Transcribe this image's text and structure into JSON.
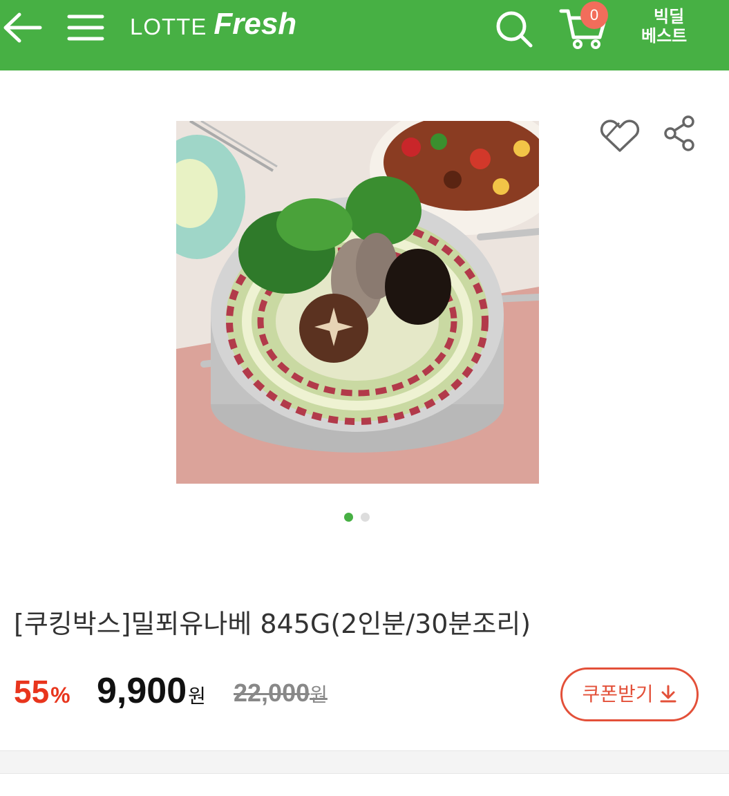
{
  "header": {
    "logo_lotte": "LOTTE",
    "logo_fresh": "Fresh",
    "cart_count": "0",
    "bigdeal_line1": "빅딜",
    "bigdeal_line2": "베스트",
    "icons": [
      "back-arrow-icon",
      "hamburger-menu-icon",
      "search-icon",
      "cart-icon"
    ],
    "accent_color": "#47b044"
  },
  "product": {
    "image_icons": [
      "wishlist-heart-icon",
      "share-icon"
    ],
    "carousel_dots": 2,
    "carousel_active": 1,
    "title": "[쿠킹박스]밀푀유나베 845G(2인분/30분조리)",
    "discount_value": "55",
    "discount_symbol": "%",
    "price": "9,900",
    "price_unit": "원",
    "original_price": "22,000",
    "original_unit": "원",
    "coupon_label": "쿠폰받기",
    "discount_color": "#e8351d"
  }
}
